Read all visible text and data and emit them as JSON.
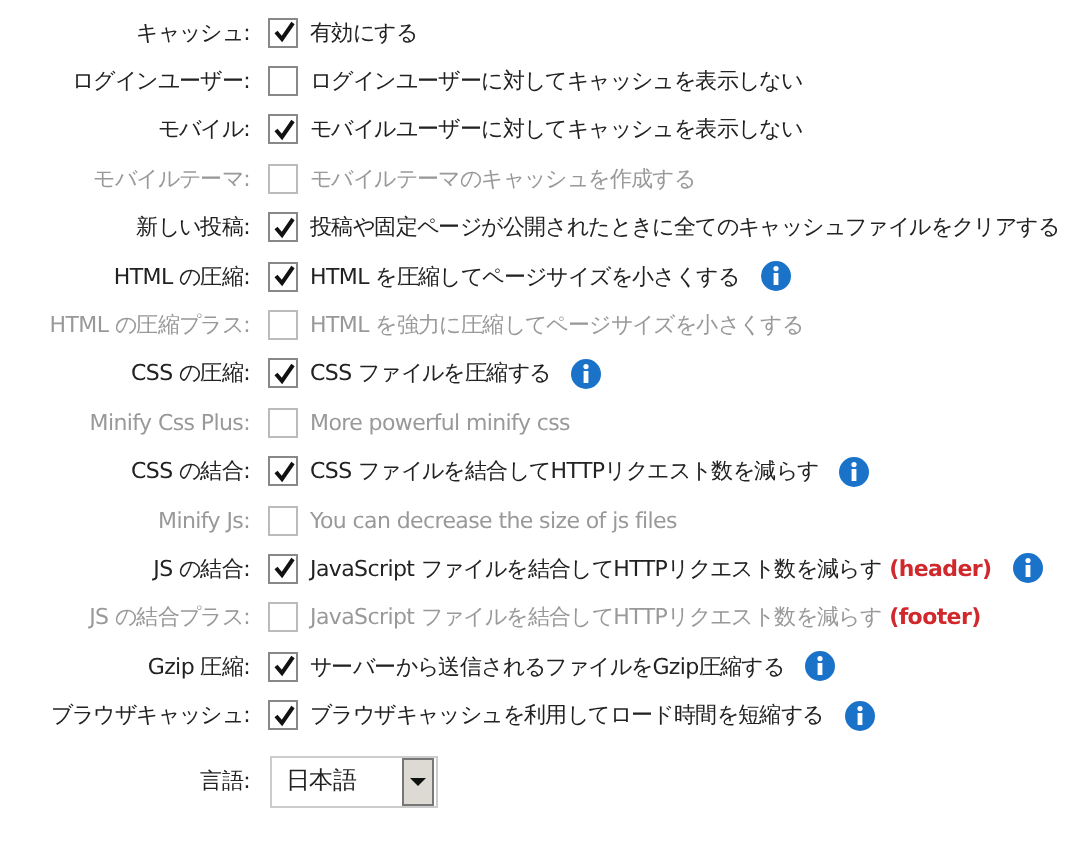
{
  "settings": [
    {
      "label": "キャッシュ:",
      "checked": true,
      "disabled": false,
      "description": "有効にする",
      "info": false
    },
    {
      "label": "ログインユーザー:",
      "checked": false,
      "disabled": false,
      "description": "ログインユーザーに対してキャッシュを表示しない",
      "info": false
    },
    {
      "label": "モバイル:",
      "checked": true,
      "disabled": false,
      "description": "モバイルユーザーに対してキャッシュを表示しない",
      "info": false
    },
    {
      "label": "モバイルテーマ:",
      "checked": false,
      "disabled": true,
      "description": "モバイルテーマのキャッシュを作成する",
      "info": false
    },
    {
      "label": "新しい投稿:",
      "checked": true,
      "disabled": false,
      "description": "投稿や固定ページが公開されたときに全てのキャッシュファイルをクリアする",
      "info": false
    },
    {
      "label": "HTML の圧縮:",
      "checked": true,
      "disabled": false,
      "description": "HTML を圧縮してページサイズを小さくする",
      "info": true
    },
    {
      "label": "HTML の圧縮プラス:",
      "checked": false,
      "disabled": true,
      "description": "HTML を強力に圧縮してページサイズを小さくする",
      "info": false
    },
    {
      "label": "CSS の圧縮:",
      "checked": true,
      "disabled": false,
      "description": "CSS ファイルを圧縮する",
      "info": true
    },
    {
      "label": "Minify Css Plus:",
      "checked": false,
      "disabled": true,
      "description": "More powerful minify css",
      "info": false
    },
    {
      "label": "CSS の結合:",
      "checked": true,
      "disabled": false,
      "description": "CSS ファイルを結合してHTTPリクエスト数を減らす",
      "info": true
    },
    {
      "label": "Minify Js:",
      "checked": false,
      "disabled": true,
      "description": "You can decrease the size of js files",
      "info": false
    },
    {
      "label": "JS の結合:",
      "checked": true,
      "disabled": false,
      "description": "JavaScript ファイルを結合してHTTPリクエスト数を減らす",
      "note": "(header)",
      "info": true
    },
    {
      "label": "JS の結合プラス:",
      "checked": false,
      "disabled": true,
      "description": "JavaScript ファイルを結合してHTTPリクエスト数を減らす",
      "note": "(footer)",
      "info": false
    },
    {
      "label": "Gzip 圧縮:",
      "checked": true,
      "disabled": false,
      "description": "サーバーから送信されるファイルをGzip圧縮する",
      "info": true
    },
    {
      "label": "ブラウザキャッシュ:",
      "checked": true,
      "disabled": false,
      "description": "ブラウザキャッシュを利用してロード時間を短縮する",
      "info": true
    }
  ],
  "language": {
    "label": "言語:",
    "value": "日本語"
  }
}
